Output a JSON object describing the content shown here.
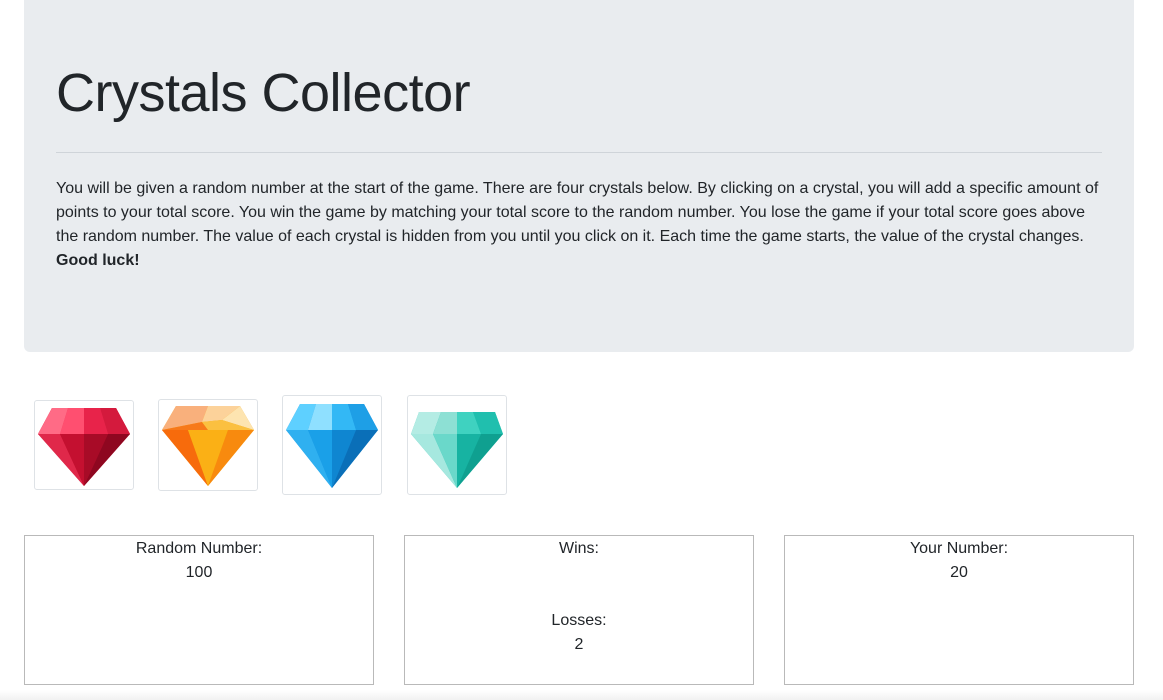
{
  "header": {
    "title": "Crystals Collector",
    "intro": "You will be given a random number at the start of the game. There are four crystals below. By clicking on a crystal, you will add a specific amount of points to your total score. You win the game by matching your total score to the random number. You lose the game if your total score goes above the random number. The value of each crystal is hidden from you until you click on it. Each time the game starts, the value of the crystal changes.",
    "intro_emphasis": "Good luck!"
  },
  "crystals": [
    {
      "name": "red-gem-icon",
      "color": "#d81c3a"
    },
    {
      "name": "orange-gem-icon",
      "color": "#f78a12"
    },
    {
      "name": "blue-gem-icon",
      "color": "#1aa0e8"
    },
    {
      "name": "teal-gem-icon",
      "color": "#19c2b0"
    }
  ],
  "stats": {
    "random_label": "Random Number:",
    "random_value": "100",
    "wins_label": "Wins:",
    "wins_value": "",
    "losses_label": "Losses:",
    "losses_value": "2",
    "your_label": "Your Number:",
    "your_value": "20"
  }
}
